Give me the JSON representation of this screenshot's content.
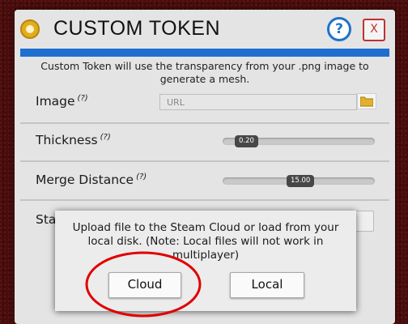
{
  "window": {
    "title": "CUSTOM TOKEN",
    "help_label": "?",
    "close_label": "X",
    "accent_color": "#1f6fd1",
    "title_icon": "token-coin-icon"
  },
  "description": "Custom Token will use the transparency from your .png image to generate a mesh.",
  "rows": {
    "image": {
      "label": "Image",
      "hint": "(?)",
      "input_placeholder": "URL",
      "browse_icon": "folder-icon"
    },
    "thickness": {
      "label": "Thickness",
      "hint": "(?)",
      "value": "0.20"
    },
    "merge_distance": {
      "label": "Merge Distance",
      "hint": "(?)",
      "value": "15.00"
    },
    "partial_row": {
      "label": "Sta"
    }
  },
  "dialog": {
    "message": "Upload file to the Steam Cloud or load from your local disk. (Note: Local files will not work in multiplayer)",
    "cloud_label": "Cloud",
    "local_label": "Local"
  },
  "annotation_color": "#e00000"
}
